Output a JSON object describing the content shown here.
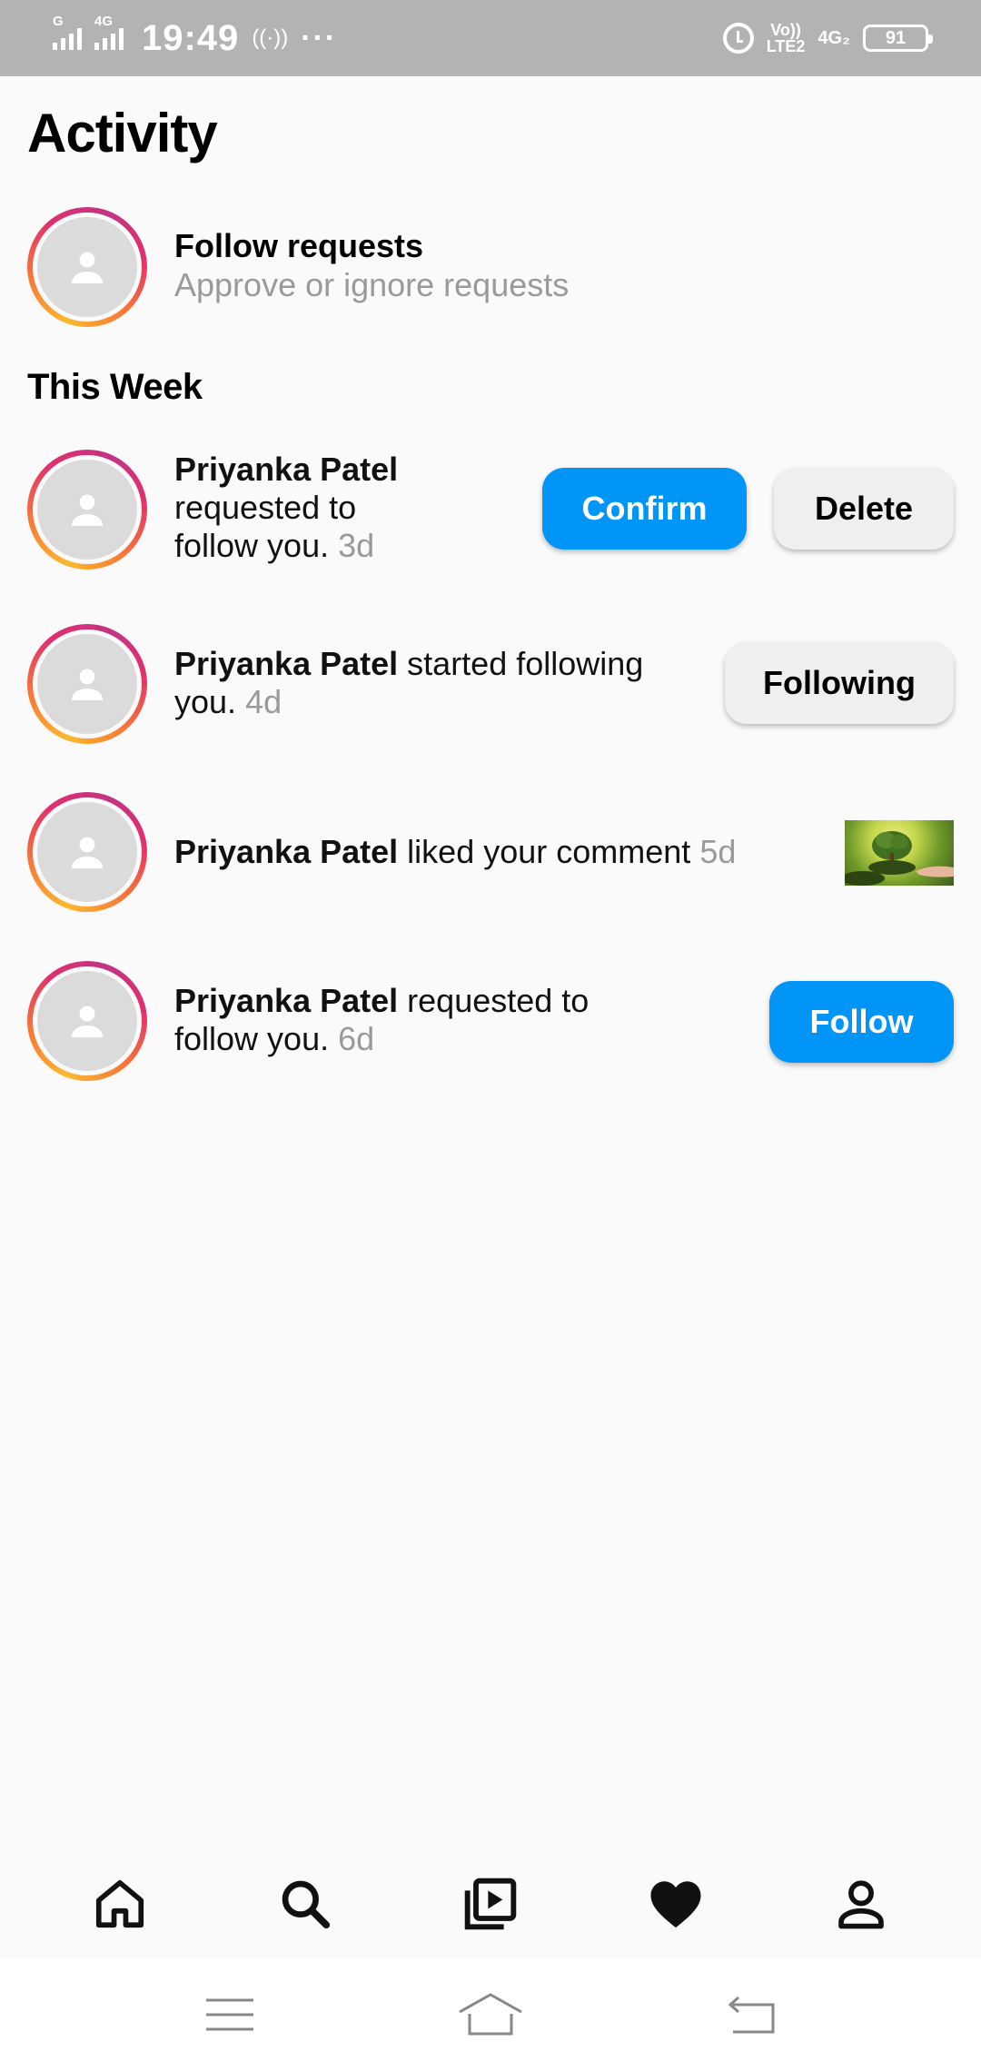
{
  "status_bar": {
    "network_1": "G",
    "network_2": "4G",
    "time": "19:49",
    "hotspot_label": "((·))",
    "more_dots": "···",
    "volte_line1": "Vo))",
    "volte_line2": "LTE2",
    "network_type": "4G₂",
    "battery": "91"
  },
  "header": {
    "title": "Activity"
  },
  "follow_requests": {
    "title": "Follow requests",
    "subtitle": "Approve or ignore requests"
  },
  "section": {
    "title": "This Week"
  },
  "notifications": [
    {
      "name": "Priyanka Patel",
      "line2": "requested to",
      "line3": "follow you.",
      "time": "3d",
      "confirm_label": "Confirm",
      "delete_label": "Delete"
    },
    {
      "name": "Priyanka Patel",
      "text": "started following",
      "line2": "you.",
      "time": "4d",
      "button_label": "Following"
    },
    {
      "name": "Priyanka Patel",
      "text": "liked your comment",
      "time": "5d"
    },
    {
      "name": "Priyanka Patel",
      "text": "requested to",
      "line2": "follow you.",
      "time": "6d",
      "button_label": "Follow"
    }
  ],
  "bottom_nav": {
    "items": [
      "home-icon",
      "search-icon",
      "reels-icon",
      "heart-icon",
      "profile-icon"
    ],
    "active": "heart-icon"
  },
  "colors": {
    "accent": "#0095f6",
    "muted_text": "#9a9a9a",
    "status_bar": "#b3b3b3",
    "background": "#fafafa"
  }
}
